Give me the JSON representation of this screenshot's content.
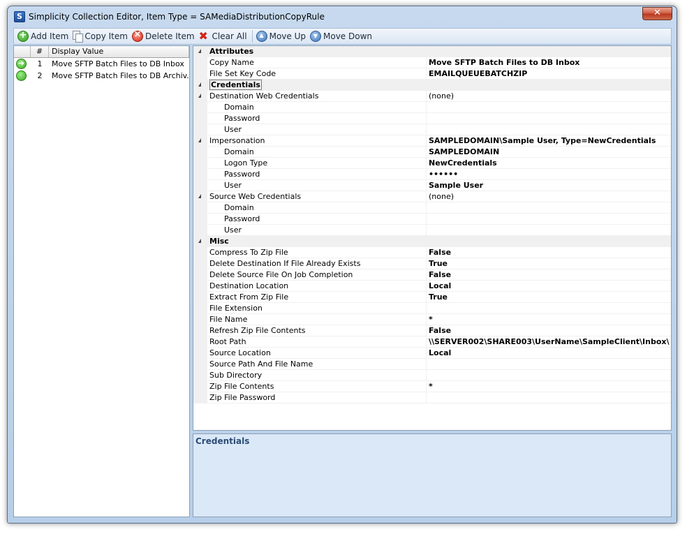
{
  "window": {
    "title": "Simplicity Collection Editor, Item Type = SAMediaDistributionCopyRule",
    "app_icon_letter": "S",
    "close_glyph": "✕"
  },
  "toolbar": {
    "add": "Add Item",
    "copy": "Copy Item",
    "delete": "Delete Item",
    "clear": "Clear All",
    "move_up": "Move Up",
    "move_down": "Move Down"
  },
  "list": {
    "headers": {
      "icon": "",
      "num": "#",
      "display": "Display Value"
    },
    "items": [
      {
        "num": "1",
        "display": "Move SFTP Batch Files to DB Inbox",
        "icon": "arrow-right-icon",
        "selected": true
      },
      {
        "num": "2",
        "display": "Move SFTP Batch Files to DB Archiv...",
        "icon": "green-dot-icon",
        "selected": false
      }
    ]
  },
  "grid": {
    "attributes": {
      "label": "Attributes",
      "copy_name": {
        "name": "Copy Name",
        "value": "Move SFTP Batch Files to DB Inbox"
      },
      "file_set_key": {
        "name": "File Set Key Code",
        "value": "EMAILQUEUEBATCHZIP"
      }
    },
    "credentials": {
      "label": "Credentials",
      "dest_web": {
        "name": "Destination Web Credentials",
        "value": "(none)",
        "domain": {
          "name": "Domain",
          "value": ""
        },
        "password": {
          "name": "Password",
          "value": ""
        },
        "user": {
          "name": "User",
          "value": ""
        }
      },
      "impersonation": {
        "name": "Impersonation",
        "value": "SAMPLEDOMAIN\\Sample User, Type=NewCredentials",
        "domain": {
          "name": "Domain",
          "value": "SAMPLEDOMAIN"
        },
        "logon_type": {
          "name": "Logon Type",
          "value": "NewCredentials"
        },
        "password": {
          "name": "Password",
          "value": "••••••"
        },
        "user": {
          "name": "User",
          "value": "Sample User"
        }
      },
      "source_web": {
        "name": "Source Web Credentials",
        "value": "(none)",
        "domain": {
          "name": "Domain",
          "value": ""
        },
        "password": {
          "name": "Password",
          "value": ""
        },
        "user": {
          "name": "User",
          "value": ""
        }
      }
    },
    "misc": {
      "label": "Misc",
      "compress": {
        "name": "Compress To Zip File",
        "value": "False"
      },
      "delete_dest": {
        "name": "Delete Destination If File Already Exists",
        "value": "True"
      },
      "delete_source": {
        "name": "Delete Source File On Job Completion",
        "value": "False"
      },
      "dest_location": {
        "name": "Destination Location",
        "value": "Local"
      },
      "extract": {
        "name": "Extract From Zip File",
        "value": "True"
      },
      "file_ext": {
        "name": "File Extension",
        "value": ""
      },
      "file_name": {
        "name": "File Name",
        "value": "*"
      },
      "refresh_zip": {
        "name": "Refresh Zip File Contents",
        "value": "False"
      },
      "root_path": {
        "name": "Root Path",
        "value": "\\\\SERVER002\\SHARE003\\UserName\\SampleClient\\Inbox\\"
      },
      "source_location": {
        "name": "Source Location",
        "value": "Local"
      },
      "source_path": {
        "name": "Source Path And File Name",
        "value": ""
      },
      "sub_dir": {
        "name": "Sub Directory",
        "value": ""
      },
      "zip_contents": {
        "name": "Zip File Contents",
        "value": "*"
      },
      "zip_password": {
        "name": "Zip File Password",
        "value": ""
      }
    }
  },
  "description": {
    "title": "Credentials"
  }
}
